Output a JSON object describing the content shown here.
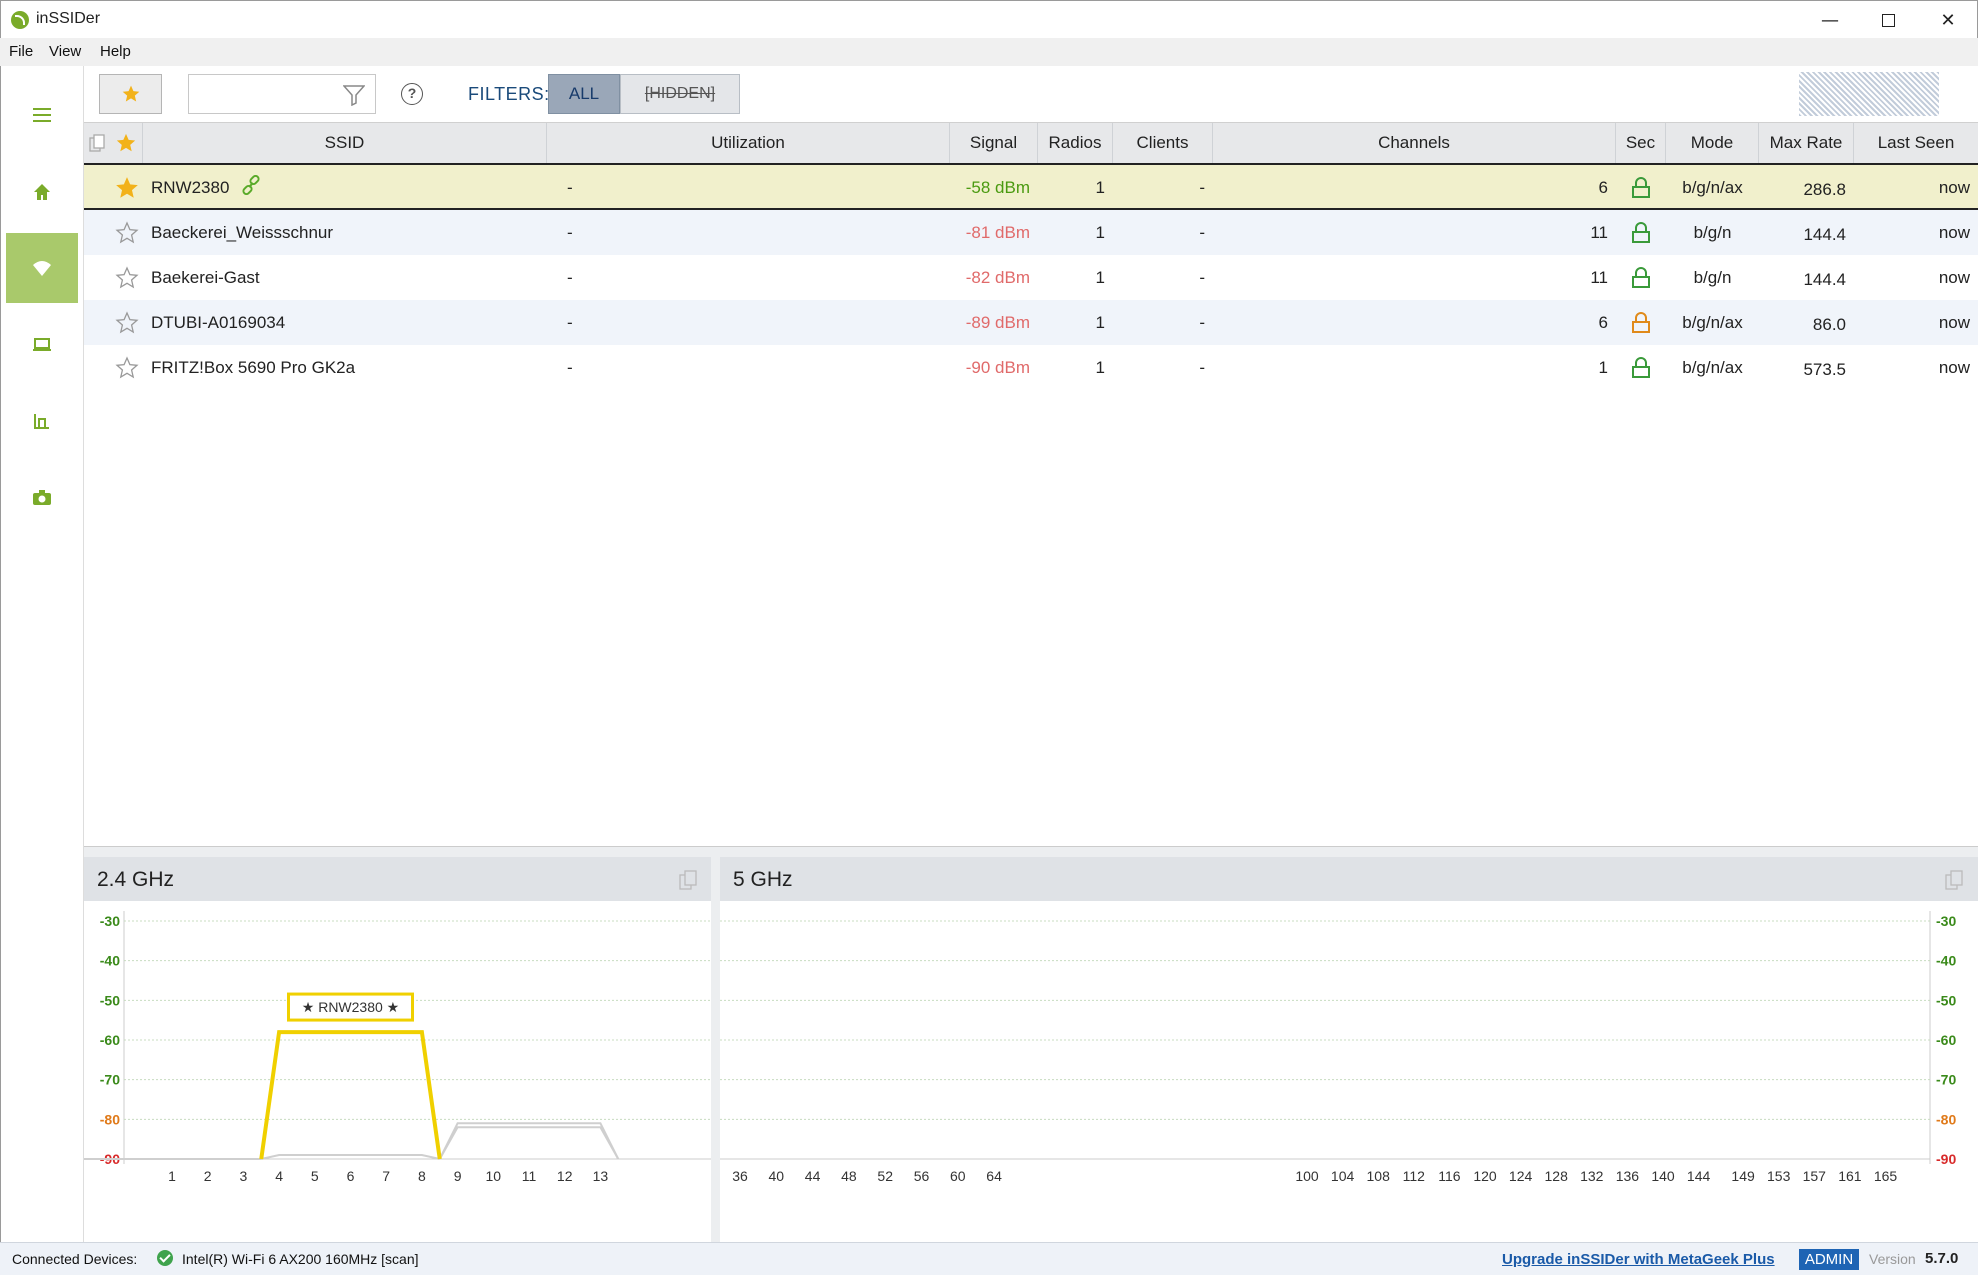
{
  "window": {
    "title": "inSSIDer",
    "min": "—",
    "close": "✕"
  },
  "menu": {
    "file": "File",
    "view": "View",
    "help": "Help"
  },
  "sidebar": {
    "items": [
      {
        "icon": "hamburger-menu-icon"
      },
      {
        "icon": "home-icon"
      },
      {
        "icon": "wifi-icon",
        "active": true
      },
      {
        "icon": "laptop-icon"
      },
      {
        "icon": "channel-graph-icon"
      },
      {
        "icon": "camera-icon"
      }
    ],
    "accent": "#a9c96b"
  },
  "toolbar": {
    "search_value": "",
    "help_symbol": "?",
    "filters_label": "FILTERS:",
    "filter_all": "ALL",
    "filter_hidden": "[HIDDEN]"
  },
  "table": {
    "headers": {
      "ssid": "SSID",
      "utilization": "Utilization",
      "signal": "Signal",
      "radios": "Radios",
      "clients": "Clients",
      "channels": "Channels",
      "sec": "Sec",
      "mode": "Mode",
      "max_rate": "Max Rate",
      "last_seen": "Last Seen"
    },
    "rows": [
      {
        "favorite": true,
        "ssid": "RNW2380",
        "connected": true,
        "utilization": "-",
        "signal": "-58 dBm",
        "signal_quality": "good",
        "radios": "1",
        "clients": "-",
        "channels": "6",
        "sec_color": "#3a9a3a",
        "mode": "b/g/n/ax",
        "max_rate": "286.8",
        "last_seen": "now"
      },
      {
        "favorite": false,
        "ssid": "Baeckerei_Weissschnur",
        "connected": false,
        "utilization": "-",
        "signal": "-81 dBm",
        "signal_quality": "bad",
        "radios": "1",
        "clients": "-",
        "channels": "11",
        "sec_color": "#3a9a3a",
        "mode": "b/g/n",
        "max_rate": "144.4",
        "last_seen": "now"
      },
      {
        "favorite": false,
        "ssid": "Baekerei-Gast",
        "connected": false,
        "utilization": "-",
        "signal": "-82 dBm",
        "signal_quality": "bad",
        "radios": "1",
        "clients": "-",
        "channels": "11",
        "sec_color": "#3a9a3a",
        "mode": "b/g/n",
        "max_rate": "144.4",
        "last_seen": "now"
      },
      {
        "favorite": false,
        "ssid": "DTUBI-A0169034",
        "connected": false,
        "utilization": "-",
        "signal": "-89 dBm",
        "signal_quality": "bad",
        "radios": "1",
        "clients": "-",
        "channels": "6",
        "sec_color": "#e08a1a",
        "mode": "b/g/n/ax",
        "max_rate": "86.0",
        "last_seen": "now"
      },
      {
        "favorite": false,
        "ssid": "FRITZ!Box 5690 Pro GK2a",
        "connected": false,
        "utilization": "-",
        "signal": "-90 dBm",
        "signal_quality": "bad",
        "radios": "1",
        "clients": "-",
        "channels": "1",
        "sec_color": "#3a9a3a",
        "mode": "b/g/n/ax",
        "max_rate": "573.5",
        "last_seen": "now"
      }
    ]
  },
  "chart_data": [
    {
      "type": "area",
      "title": "2.4 GHz",
      "y_ticks": [
        "-30",
        "-40",
        "-50",
        "-60",
        "-70",
        "-80",
        "-90"
      ],
      "ylim": [
        -90,
        -30
      ],
      "x_ticks": [
        "1",
        "2",
        "3",
        "4",
        "5",
        "6",
        "7",
        "8",
        "9",
        "10",
        "11",
        "12",
        "13"
      ],
      "xlim": [
        -2,
        16
      ],
      "series": [
        {
          "label": "★ RNW2380 ★",
          "channel": 6,
          "signal_dbm": -58,
          "color": "#f0d000",
          "highlighted": true
        },
        {
          "channel": 11,
          "signal_dbm": -81,
          "color": "#cfcfcf",
          "highlighted": false
        },
        {
          "channel": 11,
          "signal_dbm": -82,
          "color": "#cfcfcf",
          "highlighted": false
        },
        {
          "channel": 6,
          "signal_dbm": -89,
          "color": "#cfcfcf",
          "highlighted": false
        },
        {
          "channel": 1,
          "signal_dbm": -90,
          "color": "#cfcfcf",
          "highlighted": false
        }
      ]
    },
    {
      "type": "area",
      "title": "5 GHz",
      "y_ticks": [
        "-30",
        "-40",
        "-50",
        "-60",
        "-70",
        "-80",
        "-90"
      ],
      "ylim": [
        -90,
        -30
      ],
      "x_ticks": [
        "36",
        "40",
        "44",
        "48",
        "52",
        "56",
        "60",
        "64",
        "100",
        "104",
        "108",
        "112",
        "116",
        "120",
        "124",
        "128",
        "132",
        "136",
        "140",
        "144",
        "149",
        "153",
        "157",
        "161",
        "165"
      ],
      "series": []
    }
  ],
  "status": {
    "connected_label": "Connected Devices:",
    "device": "Intel(R) Wi-Fi 6 AX200 160MHz [scan]",
    "upgrade": "Upgrade inSSIDer with MetaGeek Plus",
    "admin": "ADMIN",
    "version_label": "Version",
    "version": "5.7.0"
  }
}
